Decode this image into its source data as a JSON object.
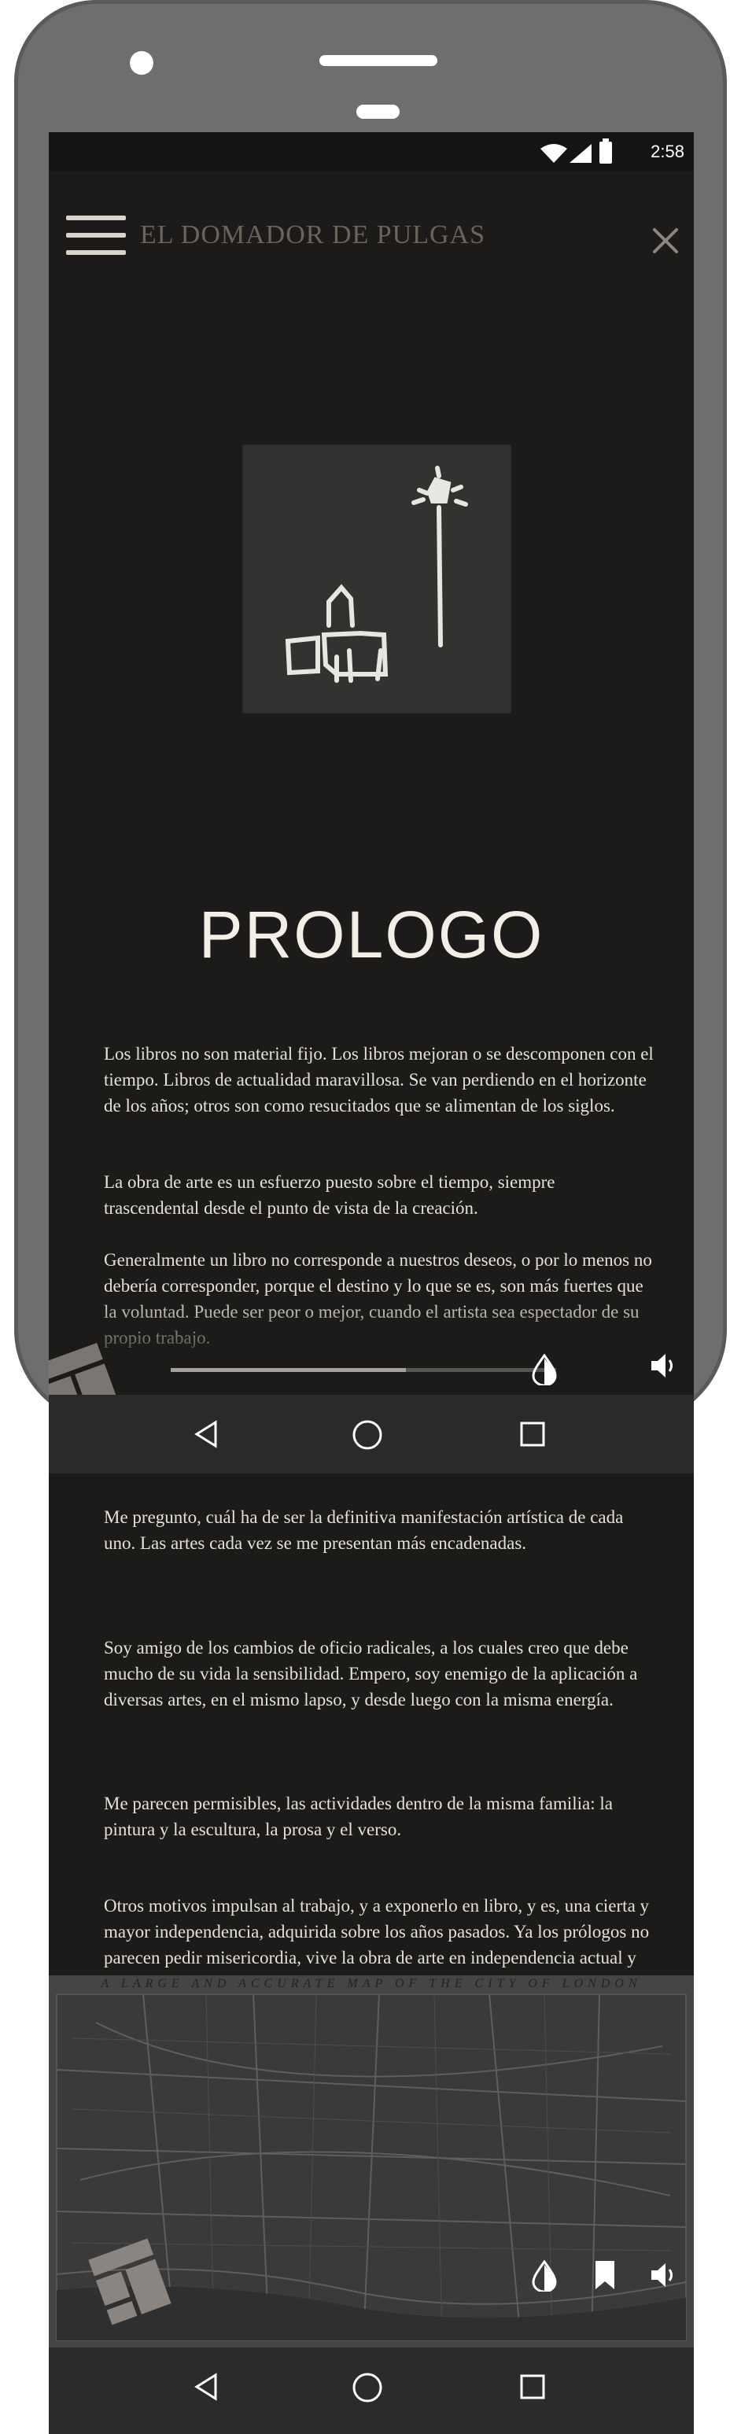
{
  "status": {
    "time": "2:58"
  },
  "app": {
    "title": "EL DOMADOR DE PULGAS"
  },
  "chapter": {
    "title": "PROLOGO"
  },
  "paragraphs": [
    "Los libros no son material fijo. Los libros mejoran o se descomponen con el tiempo. Libros de actualidad maravillosa. Se van perdiendo en el horizonte de los años; otros son como resucitados que se alimentan de los siglos.",
    "La obra de arte es un esfuerzo puesto sobre el tiempo, siempre trascendental desde el punto de vista de la creación.",
    "Generalmente un libro no corresponde a nuestros deseos, o por lo menos no debería corresponder, porque el destino y lo que se es, son más fuertes que la voluntad. Puede ser peor o mejor, cuando el artista sea espectador de su propio trabajo.",
    "Me pregunto, cuál ha de ser la definitiva manifestación artística de cada uno. Las artes cada vez se me presentan más encadenadas.",
    "Soy amigo de los cambios de oficio radicales, a los cuales creo que debe mucho de su vida la sensibilidad. Empero, soy enemigo de la aplicación a diversas artes, en el mismo lapso, y desde luego con la misma energía.",
    "Me parecen permisibles, las actividades dentro de la misma familia: la pintura y la escultura, la prosa y el verso.",
    "Otros motivos impulsan al trabajo, y a exponerlo en libro, y es, una cierta y mayor independencia, adquirida sobre los años pasados. Ya los prólogos no parecen pedir misericordia, vive la obra de arte en independencia actual y sobre el tiempo."
  ],
  "player": {
    "progress_fraction": 0.61
  },
  "map": {
    "caption": "A LARGE AND ACCURATE MAP OF THE CITY OF LONDON"
  },
  "colors": {
    "background": "#1c1b19",
    "text": "#e4e1da",
    "title_gray": "#6a655b",
    "phone": "#6e6e6e"
  },
  "icons": [
    "menu-icon",
    "close-icon",
    "wifi-icon",
    "signal-icon",
    "battery-icon",
    "contrast-icon",
    "volume-icon",
    "bookmark-icon",
    "back-icon",
    "home-icon",
    "recents-icon"
  ]
}
